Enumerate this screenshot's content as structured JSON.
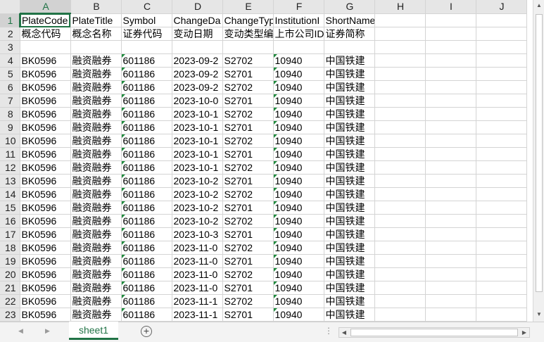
{
  "columns": [
    "A",
    "B",
    "C",
    "D",
    "E",
    "F",
    "G",
    "H",
    "I",
    "J"
  ],
  "header_row": [
    "PlateCode",
    "PlateTitle",
    "Symbol",
    "ChangeDa",
    "ChangeTyp",
    "InstitutionI",
    "ShortName",
    "",
    "",
    ""
  ],
  "label_row": [
    "概念代码",
    "概念名称",
    "证券代码",
    "变动日期",
    "变动类型编",
    "上市公司ID",
    "证券简称",
    "",
    "",
    ""
  ],
  "data_rows": [
    [
      "BK0596",
      "融资融券",
      "601186",
      "2023-09-2",
      "S2702",
      "10940",
      "中国铁建"
    ],
    [
      "BK0596",
      "融资融券",
      "601186",
      "2023-09-2",
      "S2701",
      "10940",
      "中国铁建"
    ],
    [
      "BK0596",
      "融资融券",
      "601186",
      "2023-09-2",
      "S2702",
      "10940",
      "中国铁建"
    ],
    [
      "BK0596",
      "融资融券",
      "601186",
      "2023-10-0",
      "S2701",
      "10940",
      "中国铁建"
    ],
    [
      "BK0596",
      "融资融券",
      "601186",
      "2023-10-1",
      "S2702",
      "10940",
      "中国铁建"
    ],
    [
      "BK0596",
      "融资融券",
      "601186",
      "2023-10-1",
      "S2701",
      "10940",
      "中国铁建"
    ],
    [
      "BK0596",
      "融资融券",
      "601186",
      "2023-10-1",
      "S2702",
      "10940",
      "中国铁建"
    ],
    [
      "BK0596",
      "融资融券",
      "601186",
      "2023-10-1",
      "S2701",
      "10940",
      "中国铁建"
    ],
    [
      "BK0596",
      "融资融券",
      "601186",
      "2023-10-1",
      "S2702",
      "10940",
      "中国铁建"
    ],
    [
      "BK0596",
      "融资融券",
      "601186",
      "2023-10-2",
      "S2701",
      "10940",
      "中国铁建"
    ],
    [
      "BK0596",
      "融资融券",
      "601186",
      "2023-10-2",
      "S2702",
      "10940",
      "中国铁建"
    ],
    [
      "BK0596",
      "融资融券",
      "601186",
      "2023-10-2",
      "S2701",
      "10940",
      "中国铁建"
    ],
    [
      "BK0596",
      "融资融券",
      "601186",
      "2023-10-2",
      "S2702",
      "10940",
      "中国铁建"
    ],
    [
      "BK0596",
      "融资融券",
      "601186",
      "2023-10-3",
      "S2701",
      "10940",
      "中国铁建"
    ],
    [
      "BK0596",
      "融资融券",
      "601186",
      "2023-11-0",
      "S2702",
      "10940",
      "中国铁建"
    ],
    [
      "BK0596",
      "融资融券",
      "601186",
      "2023-11-0",
      "S2701",
      "10940",
      "中国铁建"
    ],
    [
      "BK0596",
      "融资融券",
      "601186",
      "2023-11-0",
      "S2702",
      "10940",
      "中国铁建"
    ],
    [
      "BK0596",
      "融资融券",
      "601186",
      "2023-11-0",
      "S2701",
      "10940",
      "中国铁建"
    ],
    [
      "BK0596",
      "融资融券",
      "601186",
      "2023-11-1",
      "S2702",
      "10940",
      "中国铁建"
    ],
    [
      "BK0596",
      "融资融券",
      "601186",
      "2023-11-1",
      "S2701",
      "10940",
      "中国铁建"
    ]
  ],
  "tabs": {
    "sheet1": "sheet1",
    "add": "+"
  },
  "icons": {
    "nav_prev": "prev-sheet-icon",
    "nav_next": "next-sheet-icon",
    "add_sheet": "plus-icon",
    "tab_menu": "more-dots-icon"
  },
  "colors": {
    "accent": "#217346",
    "triangle": "#1e8a3c",
    "header_bg": "#e6e6e6",
    "grid_line": "#d4d4d4"
  }
}
